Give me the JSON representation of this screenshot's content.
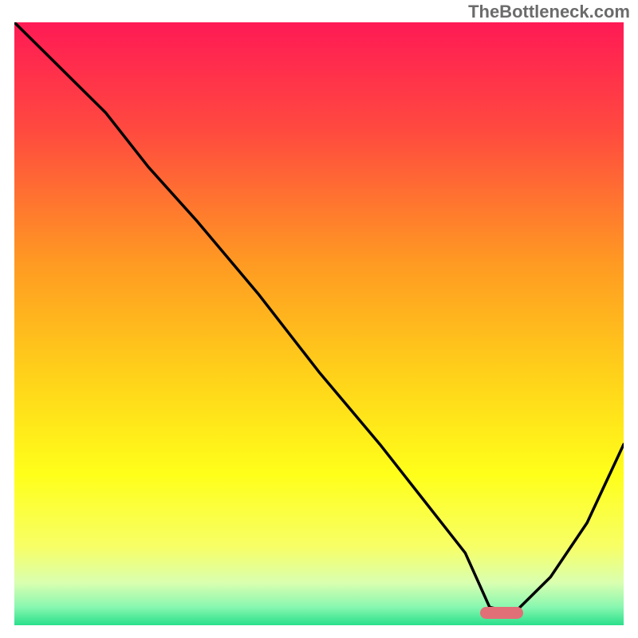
{
  "watermark": "TheBottleneck.com",
  "chart_data": {
    "type": "line",
    "title": "",
    "xlabel": "",
    "ylabel": "",
    "xlim": [
      0,
      100
    ],
    "ylim": [
      0,
      100
    ],
    "grid": false,
    "gradient": {
      "stops": [
        {
          "pos": 0.0,
          "color": "#ff1a55"
        },
        {
          "pos": 0.18,
          "color": "#ff4a3f"
        },
        {
          "pos": 0.4,
          "color": "#ff9a22"
        },
        {
          "pos": 0.58,
          "color": "#ffd01a"
        },
        {
          "pos": 0.75,
          "color": "#ffff1a"
        },
        {
          "pos": 0.87,
          "color": "#f7ff66"
        },
        {
          "pos": 0.93,
          "color": "#d9ffb0"
        },
        {
          "pos": 0.97,
          "color": "#88f7b0"
        },
        {
          "pos": 1.0,
          "color": "#29e08b"
        }
      ]
    },
    "series": [
      {
        "name": "bottleneck-curve",
        "x": [
          0,
          5,
          10,
          15,
          22,
          30,
          40,
          50,
          60,
          67,
          74,
          78,
          82,
          88,
          94,
          100
        ],
        "y": [
          100,
          95,
          90,
          85,
          76,
          67,
          55,
          42,
          30,
          21,
          12,
          3,
          2,
          8,
          17,
          30
        ]
      }
    ],
    "marker": {
      "x": 80,
      "y": 2,
      "width_pct": 7,
      "height_pct": 2,
      "color": "#e16f77"
    }
  }
}
